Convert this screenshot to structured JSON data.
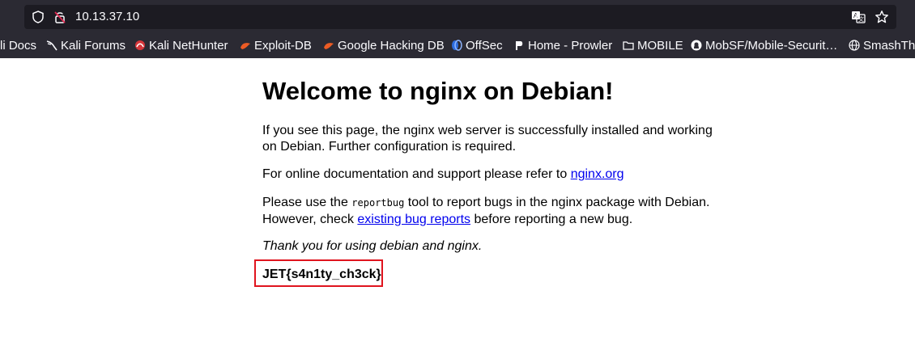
{
  "browser": {
    "url": "10.13.37.10",
    "bookmarks": [
      {
        "label": "li Docs",
        "icon": "kali-docs-icon"
      },
      {
        "label": "Kali Forums",
        "icon": "kali-dragon-icon"
      },
      {
        "label": "Kali NetHunter",
        "icon": "nethunter-icon"
      },
      {
        "label": "Exploit-DB",
        "icon": "exploit-db-icon"
      },
      {
        "label": "Google Hacking DB",
        "icon": "ghdb-icon"
      },
      {
        "label": "OffSec",
        "icon": "offsec-icon"
      },
      {
        "label": "Home - Prowler",
        "icon": "prowler-icon"
      },
      {
        "label": "MOBILE",
        "icon": "folder-icon"
      },
      {
        "label": "MobSF/Mobile-Securit…",
        "icon": "github-icon"
      },
      {
        "label": "SmashThe",
        "icon": "globe-icon"
      }
    ]
  },
  "page": {
    "heading": "Welcome to nginx on Debian!",
    "p1": "If you see this page, the nginx web server is successfully installed and working on Debian. Further configuration is required.",
    "p2_text": "For online documentation and support please refer to ",
    "p2_link": "nginx.org",
    "p3_pre": "Please use the ",
    "p3_code": "reportbug",
    "p3_mid": " tool to report bugs in the nginx package with Debian. However, check ",
    "p3_link": "existing bug reports",
    "p3_post": " before reporting a new bug.",
    "p4": "Thank you for using debian and nginx.",
    "flag": "JET{s4n1ty_ch3ck}"
  },
  "colors": {
    "toolbar_bg": "#2b2a33",
    "urlbar_bg": "#1c1b22",
    "highlight_border": "#e0141e"
  }
}
